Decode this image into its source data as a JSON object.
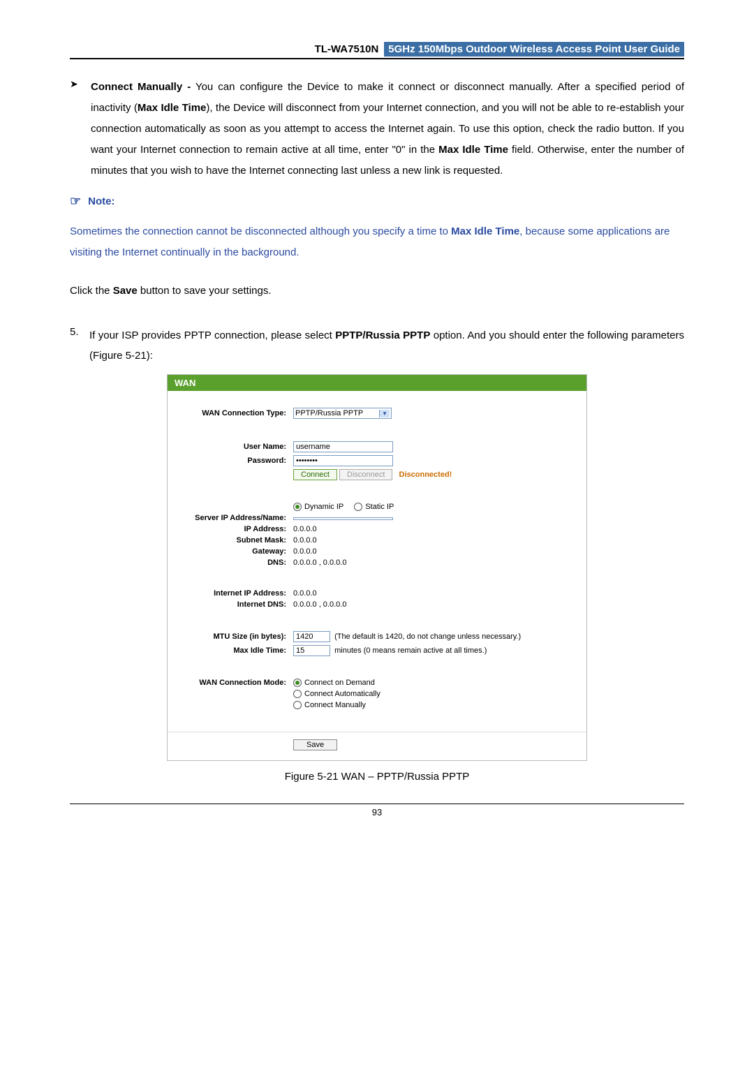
{
  "header": {
    "model": "TL-WA7510N",
    "subtitle": "5GHz 150Mbps Outdoor Wireless Access Point User Guide"
  },
  "bullet": {
    "lead": "Connect Manually -",
    "text_part1": " You can configure the Device to make it connect or disconnect manually. After a specified period of inactivity (",
    "bold1": "Max Idle Time",
    "text_part2": "), the Device will disconnect from your Internet connection, and you will not be able to re-establish your connection automatically as soon as you attempt to access the Internet again. To use this option, check the radio button. If you want your Internet connection to remain active at all time, enter \"0\" in the ",
    "bold2": "Max Idle Time",
    "text_part3": " field. Otherwise, enter the number of minutes that you wish to have the Internet connecting last unless a new link is requested."
  },
  "note": {
    "label": "Note:",
    "body_part1": "Sometimes the connection cannot be disconnected although you specify a time to ",
    "bold": "Max Idle Time",
    "body_part2": ", because some applications are visiting the Internet continually in the background."
  },
  "save_line": {
    "pre": "Click the ",
    "bold": "Save",
    "post": " button to save your settings."
  },
  "item5": {
    "num": "5.",
    "pre": "If your ISP provides PPTP connection, please select ",
    "bold": "PPTP/Russia PPTP",
    "post": " option. And you should enter the following parameters (Figure 5-21):"
  },
  "figure": {
    "title": "WAN",
    "labels": {
      "conn_type": "WAN Connection Type:",
      "username": "User Name:",
      "password": "Password:",
      "server": "Server IP Address/Name:",
      "ip": "IP Address:",
      "subnet": "Subnet Mask:",
      "gateway": "Gateway:",
      "dns": "DNS:",
      "internet_ip": "Internet IP Address:",
      "internet_dns": "Internet DNS:",
      "mtu": "MTU Size (in bytes):",
      "max_idle": "Max Idle Time:",
      "conn_mode": "WAN Connection Mode:"
    },
    "values": {
      "conn_type": "PPTP/Russia PPTP",
      "username": "username",
      "password": "••••••••",
      "connect_btn": "Connect",
      "disconnect_btn": "Disconnect",
      "status": "Disconnected!",
      "radio_dynamic": "Dynamic IP",
      "radio_static": "Static IP",
      "ip": "0.0.0.0",
      "subnet": "0.0.0.0",
      "gateway": "0.0.0.0",
      "dns": "0.0.0.0 , 0.0.0.0",
      "internet_ip": "0.0.0.0",
      "internet_dns": "0.0.0.0 , 0.0.0.0",
      "mtu": "1420",
      "mtu_hint": "(The default is 1420, do not change unless necessary.)",
      "max_idle": "15",
      "max_idle_hint": "minutes (0 means remain active at all times.)",
      "mode_demand": "Connect on Demand",
      "mode_auto": "Connect Automatically",
      "mode_manual": "Connect Manually",
      "save_btn": "Save"
    }
  },
  "caption": "Figure 5-21 WAN – PPTP/Russia PPTP",
  "page_number": "93"
}
